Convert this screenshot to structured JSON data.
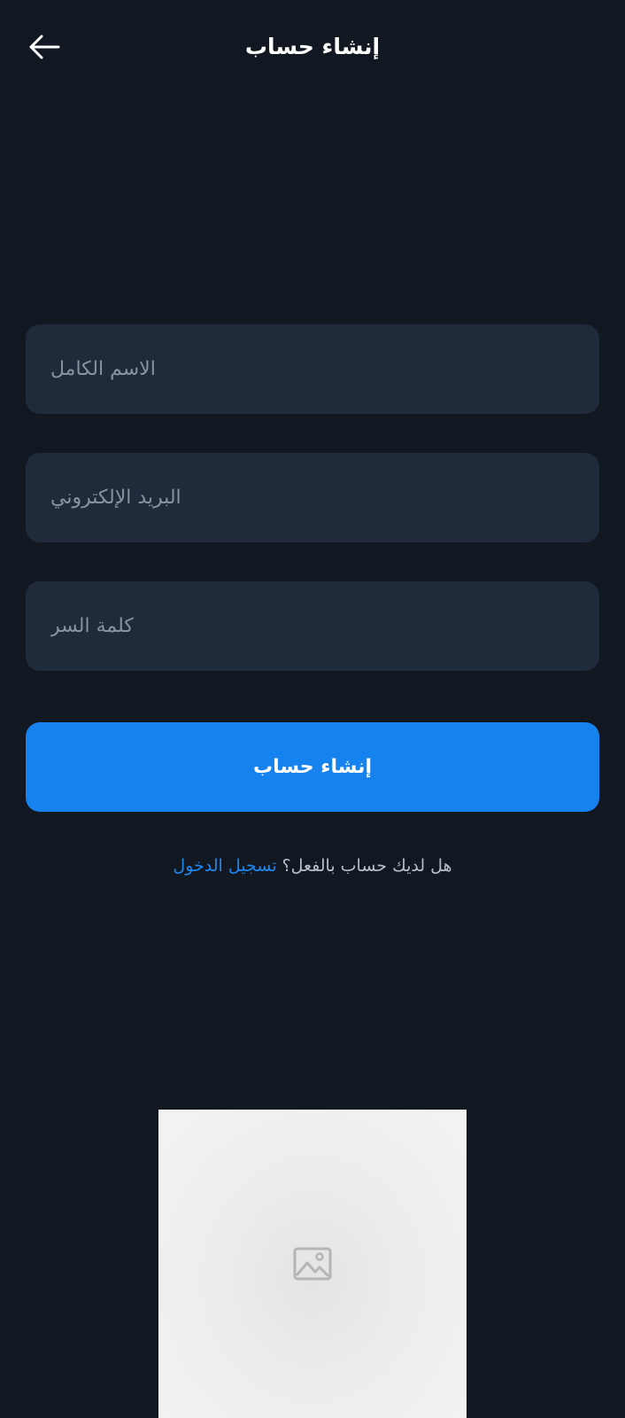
{
  "header": {
    "title": "إنشاء حساب",
    "back_icon": "arrow-left-icon"
  },
  "form": {
    "full_name": {
      "placeholder": "الاسم الكامل",
      "value": ""
    },
    "email": {
      "placeholder": "البريد الإلكتروني",
      "value": ""
    },
    "password": {
      "placeholder": "كلمة السر",
      "value": ""
    }
  },
  "submit": {
    "label": "إنشاء حساب",
    "color": "#1682ee"
  },
  "signin": {
    "question": "هل لديك حساب بالفعل؟",
    "link": "تسجيل الدخول",
    "link_color": "#1f86ec"
  },
  "media": {
    "icon": "image-placeholder-icon"
  },
  "colors": {
    "background": "#111821",
    "field_background": "#1f2a3a"
  }
}
